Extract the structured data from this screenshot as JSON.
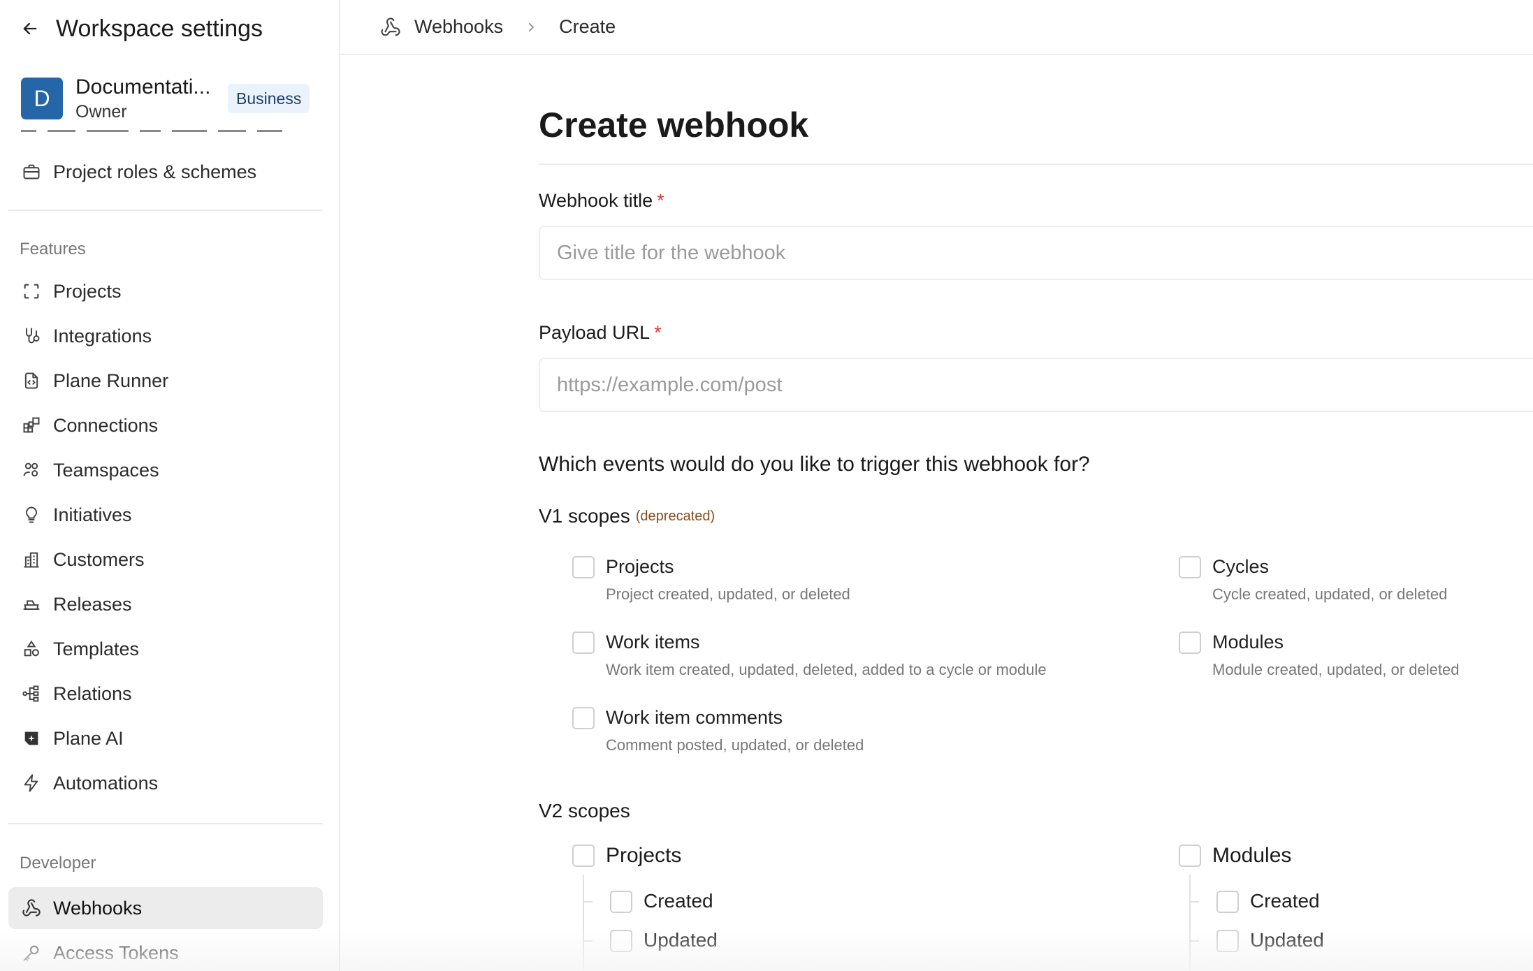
{
  "sidebar": {
    "header_title": "Workspace settings",
    "workspace": {
      "avatar_letter": "D",
      "name": "Documentati...",
      "role": "Owner",
      "plan_badge": "Business"
    },
    "top_items": [
      {
        "label": "Project roles & schemes",
        "icon": "briefcase-icon"
      }
    ],
    "features_heading": "Features",
    "features": [
      {
        "label": "Projects",
        "icon": "projects-icon"
      },
      {
        "label": "Integrations",
        "icon": "integrations-icon"
      },
      {
        "label": "Plane Runner",
        "icon": "runner-script-icon"
      },
      {
        "label": "Connections",
        "icon": "connections-icon"
      },
      {
        "label": "Teamspaces",
        "icon": "teamspaces-icon"
      },
      {
        "label": "Initiatives",
        "icon": "lightbulb-icon"
      },
      {
        "label": "Customers",
        "icon": "building-icon"
      },
      {
        "label": "Releases",
        "icon": "ship-icon"
      },
      {
        "label": "Templates",
        "icon": "shapes-icon"
      },
      {
        "label": "Relations",
        "icon": "relations-icon"
      },
      {
        "label": "Plane AI",
        "icon": "plane-ai-icon"
      },
      {
        "label": "Automations",
        "icon": "lightning-icon"
      }
    ],
    "developer_heading": "Developer",
    "developer": [
      {
        "label": "Webhooks",
        "icon": "webhook-icon",
        "active": true
      },
      {
        "label": "Access Tokens",
        "icon": "key-icon",
        "active": false
      }
    ]
  },
  "breadcrumb": {
    "parent": "Webhooks",
    "current": "Create"
  },
  "form": {
    "title": "Create webhook",
    "webhook_title_label": "Webhook title",
    "webhook_title_placeholder": "Give title for the webhook",
    "payload_url_label": "Payload URL",
    "payload_url_placeholder": "https://example.com/post",
    "required_mark": "*",
    "question": "Which events would do you like to trigger this webhook for?",
    "v1": {
      "heading": "V1 scopes",
      "deprecated": "(deprecated)",
      "options": [
        {
          "title": "Projects",
          "desc": "Project created, updated, or deleted"
        },
        {
          "title": "Cycles",
          "desc": "Cycle created, updated, or deleted"
        },
        {
          "title": "Work items",
          "desc": "Work item created, updated, deleted, added to a cycle or module"
        },
        {
          "title": "Modules",
          "desc": "Module created, updated, or deleted"
        },
        {
          "title": "Work item comments",
          "desc": "Comment posted, updated, or deleted"
        }
      ]
    },
    "v2": {
      "heading": "V2 scopes",
      "groups": [
        {
          "title": "Projects",
          "subs": [
            "Created",
            "Updated"
          ]
        },
        {
          "title": "Modules",
          "subs": [
            "Created",
            "Updated"
          ]
        }
      ]
    }
  },
  "colors": {
    "accent": "#2566a8",
    "required": "#d63b3b",
    "deprecated": "#8a4b1b",
    "active_item_bg": "#ececec"
  }
}
